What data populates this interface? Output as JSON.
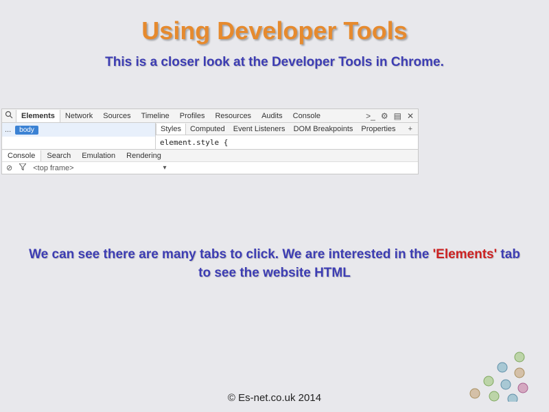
{
  "title": "Using Developer Tools",
  "subtitle": "This is a closer look at the Developer Tools in Chrome.",
  "devtools": {
    "tabs": [
      "Elements",
      "Network",
      "Sources",
      "Timeline",
      "Profiles",
      "Resources",
      "Audits",
      "Console"
    ],
    "active_tab": "Elements",
    "breadcrumb_ellipsis": "...",
    "breadcrumb_body": "body",
    "styles_tabs": [
      "Styles",
      "Computed",
      "Event Listeners",
      "DOM Breakpoints",
      "Properties"
    ],
    "styles_active": "Styles",
    "element_style": "element.style {",
    "console_tabs": [
      "Console",
      "Search",
      "Emulation",
      "Rendering"
    ],
    "console_active": "Console",
    "frame_label": "<top frame>",
    "plus": "+"
  },
  "body_text": {
    "line1_pre": "We can see there are many tabs to click. We are interested in the ",
    "highlight": "'Elements'",
    "line1_post": " tab to see the website HTML"
  },
  "footer": "© Es-net.co.uk 2014"
}
